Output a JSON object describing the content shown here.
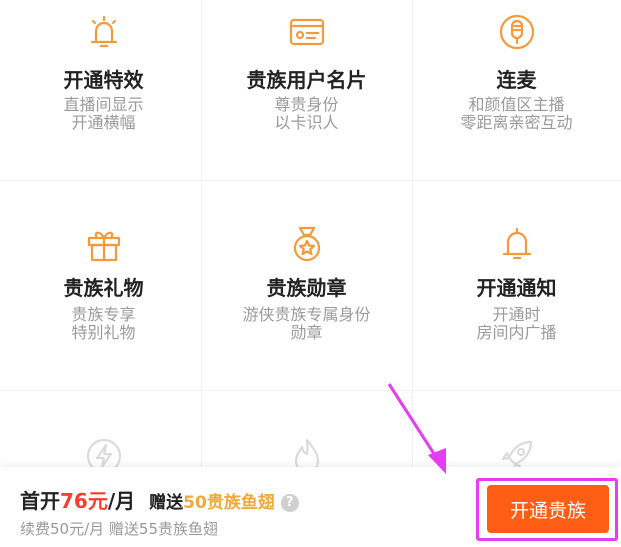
{
  "features": [
    {
      "title": "开通特效",
      "desc1": "直播间显示",
      "desc2": "开通横幅",
      "icon": "bell-icon"
    },
    {
      "title": "贵族用户名片",
      "desc1": "尊贵身份",
      "desc2": "以卡识人",
      "icon": "id-card-icon"
    },
    {
      "title": "连麦",
      "desc1": "和颜值区主播",
      "desc2": "零距离亲密互动",
      "icon": "microphone-icon"
    },
    {
      "title": "贵族礼物",
      "desc1": "贵族专享",
      "desc2": "特别礼物",
      "icon": "gift-icon"
    },
    {
      "title": "贵族勋章",
      "desc1": "游侠贵族专属身份",
      "desc2": "勋章",
      "icon": "medal-icon"
    },
    {
      "title": "开通通知",
      "desc1": "开通时",
      "desc2": "房间内广播",
      "icon": "bell-icon"
    }
  ],
  "partial_row_icons": [
    "lightning-icon",
    "flame-icon",
    "rocket-icon"
  ],
  "bottom_bar": {
    "first_prefix": "首开",
    "first_price": "76元",
    "first_suffix": "/月",
    "gift_prefix": "赠送",
    "gift_value": "50贵族鱼翅",
    "help": "?",
    "renew": "续费50元/月   赠送55贵族鱼翅",
    "button": "开通贵族"
  },
  "colors": {
    "accent": "#ff5e14",
    "icon": "#f39a3d",
    "price": "#ff3b30",
    "gold": "#f2a93b",
    "highlight": "#e53ef2"
  }
}
